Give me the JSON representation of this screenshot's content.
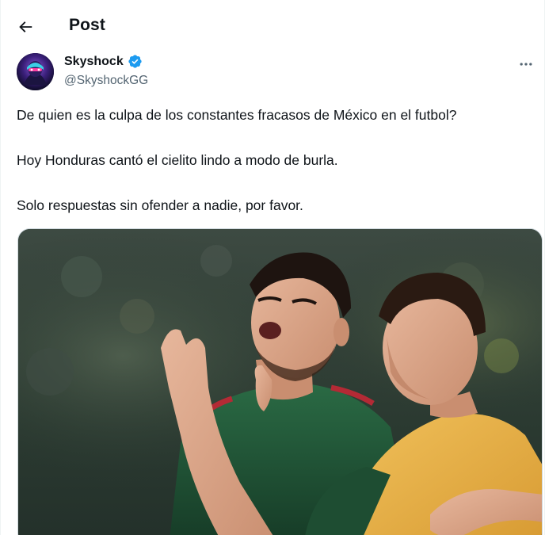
{
  "header": {
    "title": "Post",
    "back_icon": "arrow-left-icon"
  },
  "author": {
    "name": "Skyshock",
    "handle": "@SkyshockGG",
    "verified_icon": "verified-badge-icon",
    "verified_color": "#1d9bf0",
    "more_icon": "more-horizontal-icon"
  },
  "tweet": {
    "lines": [
      "De quien es la culpa de los constantes fracasos de México en el futbol?",
      "Hoy Honduras cantó el cielito lindo a modo de burla.",
      "Solo respuestas sin ofender a nadie, por favor."
    ]
  },
  "media": {
    "type": "photo",
    "accent_colors": {
      "jersey_green": "#1e4d32",
      "bib_yellow": "#e8b24a"
    }
  },
  "colors": {
    "text_primary": "#0f1419",
    "text_secondary": "#536471",
    "accent": "#1d9bf0"
  }
}
